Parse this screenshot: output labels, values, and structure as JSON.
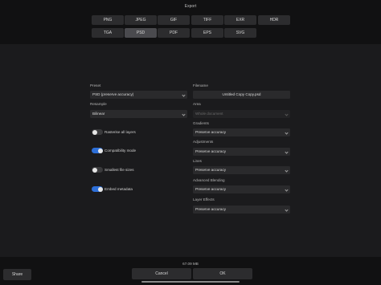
{
  "title": "Export",
  "formats": [
    {
      "label": "PNG",
      "active": false
    },
    {
      "label": "JPEG",
      "active": false
    },
    {
      "label": "GIF",
      "active": false
    },
    {
      "label": "TIFF",
      "active": false
    },
    {
      "label": "EXR",
      "active": false
    },
    {
      "label": "HDR",
      "active": false
    },
    {
      "label": "TGA",
      "active": false
    },
    {
      "label": "PSD",
      "active": true
    },
    {
      "label": "PDF",
      "active": false
    },
    {
      "label": "EPS",
      "active": false
    },
    {
      "label": "SVG",
      "active": false
    }
  ],
  "left": {
    "preset_label": "Preset",
    "preset_value": "PSD (preserve accuracy)",
    "resample_label": "Resample",
    "resample_value": "Bilinear",
    "toggles": [
      {
        "label": "Rasterise all layers",
        "on": false
      },
      {
        "label": "Compatibility mode",
        "on": true
      },
      {
        "label": "Smallest file sizes",
        "on": false
      },
      {
        "label": "Embed metadata",
        "on": true
      }
    ]
  },
  "right": {
    "filename_label": "Filename",
    "filename_value": "Untitled Copy Copy.psd",
    "area_label": "Area",
    "area_value": "Whole document",
    "gradients_label": "Gradients",
    "gradients_value": "Preserve accuracy",
    "adjustments_label": "Adjustments",
    "adjustments_value": "Preserve accuracy",
    "lines_label": "Lines",
    "lines_value": "Preserve accuracy",
    "advanced_blending_label": "Advanced Blending",
    "advanced_blending_value": "Preserve accuracy",
    "layer_effects_label": "Layer Effects",
    "layer_effects_value": "Preserve accuracy"
  },
  "footer": {
    "file_size": "67.09 MB",
    "share_label": "Share",
    "cancel_label": "Cancel",
    "ok_label": "OK"
  }
}
